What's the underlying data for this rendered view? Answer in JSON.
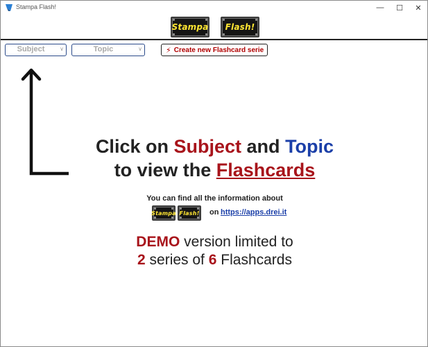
{
  "window": {
    "title": "Stampa Flash!",
    "controls": {
      "minimize": "—",
      "maximize": "☐",
      "close": "✕"
    }
  },
  "header": {
    "logo_left": "Stampa",
    "logo_right": "Flash!"
  },
  "toolbar": {
    "subject_value": "Subject",
    "topic_value": "Topic",
    "create_label": "Create new Flashcard serie"
  },
  "main": {
    "line1_a": "Click on",
    "line1_subject": "Subject",
    "line1_and": "and",
    "line1_topic": "Topic",
    "line2_a": "to view the",
    "line2_flashcards": "Flashcards"
  },
  "info": {
    "text": "You can find all the information about",
    "logo_left": "Stampa",
    "logo_right": "Flash!",
    "on": "on",
    "link": "https://apps.drei.it"
  },
  "demo": {
    "word": "DEMO",
    "rest1": "version limited to",
    "count_series": "2",
    "mid": "series of",
    "count_cards": "6",
    "tail": "Flashcards"
  },
  "colors": {
    "accent_red": "#a8141b",
    "accent_blue": "#1b3fa8",
    "logo_yellow": "#ffe633",
    "logo_bg": "#151515"
  }
}
